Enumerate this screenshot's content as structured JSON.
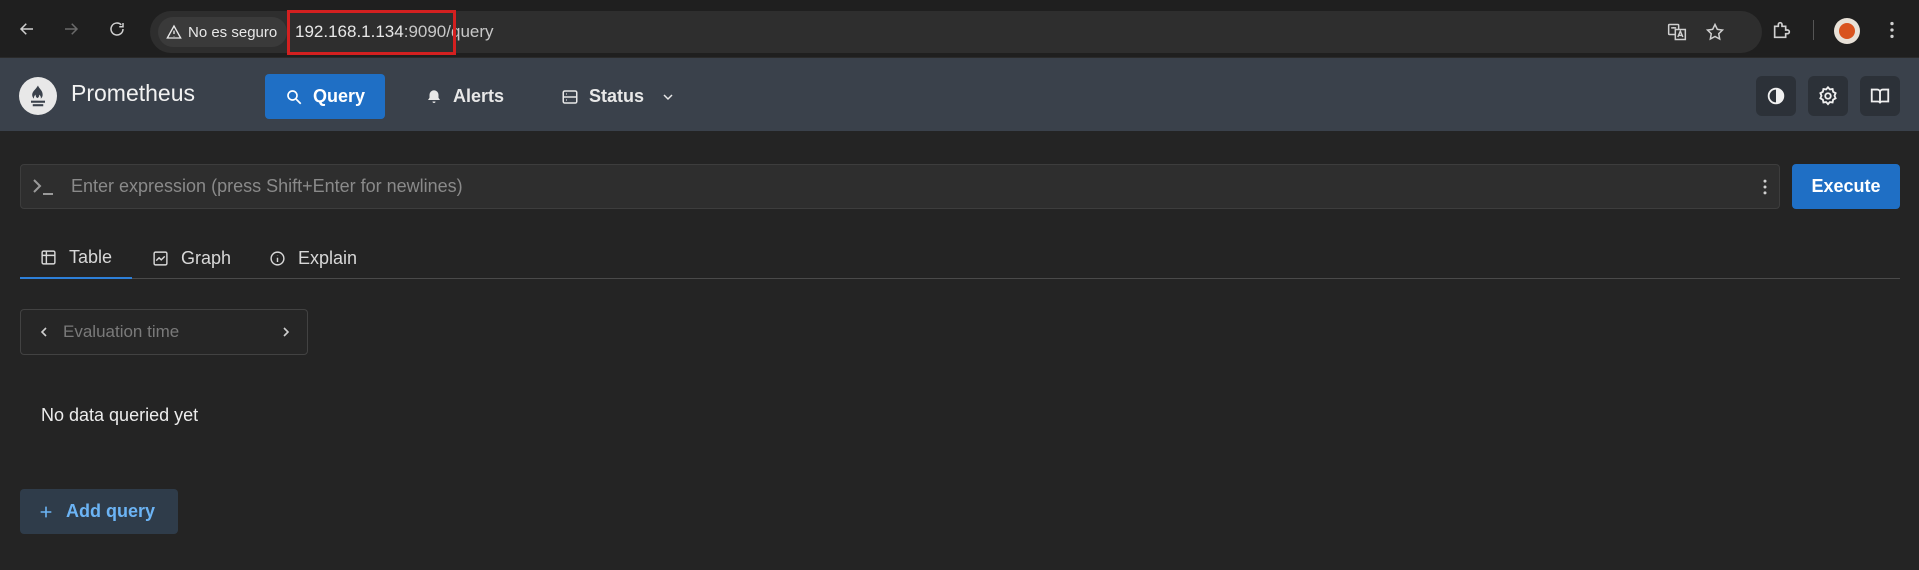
{
  "browser": {
    "security_label": "No es seguro",
    "url_host": "192.168.1.134",
    "url_port": ":9090/",
    "url_path": "query"
  },
  "navbar": {
    "brand": "Prometheus",
    "items": [
      {
        "label": "Query",
        "icon": "search-icon",
        "active": true
      },
      {
        "label": "Alerts",
        "icon": "bell-icon",
        "active": false
      },
      {
        "label": "Status",
        "icon": "server-icon",
        "active": false
      }
    ]
  },
  "query": {
    "expression_placeholder": "Enter expression (press Shift+Enter for newlines)",
    "execute_label": "Execute",
    "tabs": [
      {
        "label": "Table",
        "icon": "table-icon",
        "active": true
      },
      {
        "label": "Graph",
        "icon": "graph-icon",
        "active": false
      },
      {
        "label": "Explain",
        "icon": "info-icon",
        "active": false
      }
    ],
    "evaluation_time_placeholder": "Evaluation time",
    "empty_message": "No data queried yet",
    "add_query_label": "Add query"
  },
  "colors": {
    "accent": "#1f6fc5",
    "navbar_bg": "#3a414b",
    "page_bg": "#242424",
    "highlight": "#d32020"
  }
}
